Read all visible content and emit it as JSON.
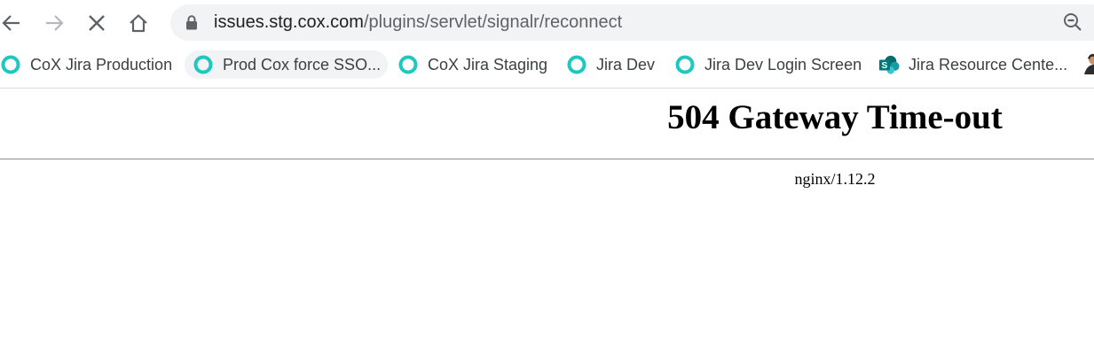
{
  "browser": {
    "url_host": "issues.stg.cox.com",
    "url_path": "/plugins/servlet/signalr/reconnect",
    "icons": {
      "back": "arrow-left-icon",
      "forward": "arrow-right-icon",
      "stop": "close-icon",
      "home": "home-icon",
      "lock": "lock-icon",
      "zoom": "zoom-out-icon"
    }
  },
  "bookmarks": [
    {
      "label": "CoX Jira Production",
      "icon": "jira-ring-icon"
    },
    {
      "label": "Prod Cox force SSO...",
      "icon": "jira-ring-icon"
    },
    {
      "label": "CoX Jira Staging",
      "icon": "jira-ring-icon"
    },
    {
      "label": "Jira Dev",
      "icon": "jira-ring-icon"
    },
    {
      "label": "Jira Dev Login Screen",
      "icon": "jira-ring-icon"
    },
    {
      "label": "Jira Resource Cente...",
      "icon": "sharepoint-icon"
    }
  ],
  "page": {
    "title": "504 Gateway Time-out",
    "server": "nginx/1.12.2"
  },
  "colors": {
    "ring": "#1fc7c0",
    "sharepoint": "#038387",
    "omnibox_bg": "#f1f3f4"
  }
}
